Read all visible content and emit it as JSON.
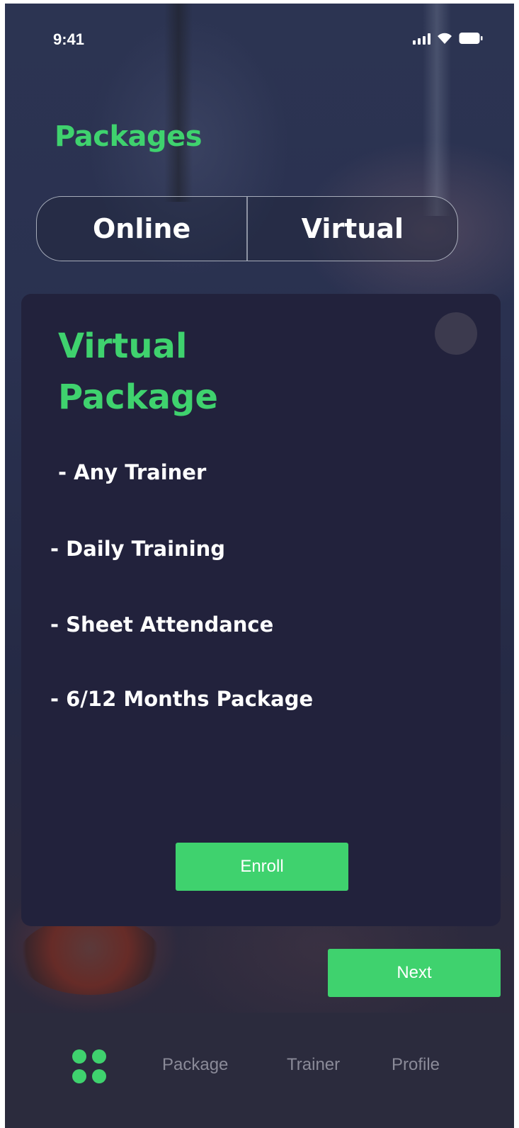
{
  "status_bar": {
    "time": "9:41",
    "icons": [
      "signal-icon",
      "wifi-icon",
      "battery-icon"
    ]
  },
  "header": {
    "title": "Packages"
  },
  "tabs": [
    {
      "label": "Online"
    },
    {
      "label": "Virtual"
    }
  ],
  "card": {
    "title": "Virtual Package",
    "features": [
      " - Any Trainer",
      "- Daily Training",
      "- Sheet Attendance",
      "- 6/12 Months Package"
    ],
    "enroll_label": "Enroll"
  },
  "next_label": "Next",
  "bottom_nav": {
    "home_icon": "grid-dots-icon",
    "items": [
      {
        "label": "Package"
      },
      {
        "label": "Trainer"
      },
      {
        "label": "Profile"
      }
    ]
  },
  "colors": {
    "accent": "#3fd26e",
    "card_bg": "#22223c",
    "nav_bg": "#2b2b3d",
    "nav_text": "#8a8a98"
  }
}
